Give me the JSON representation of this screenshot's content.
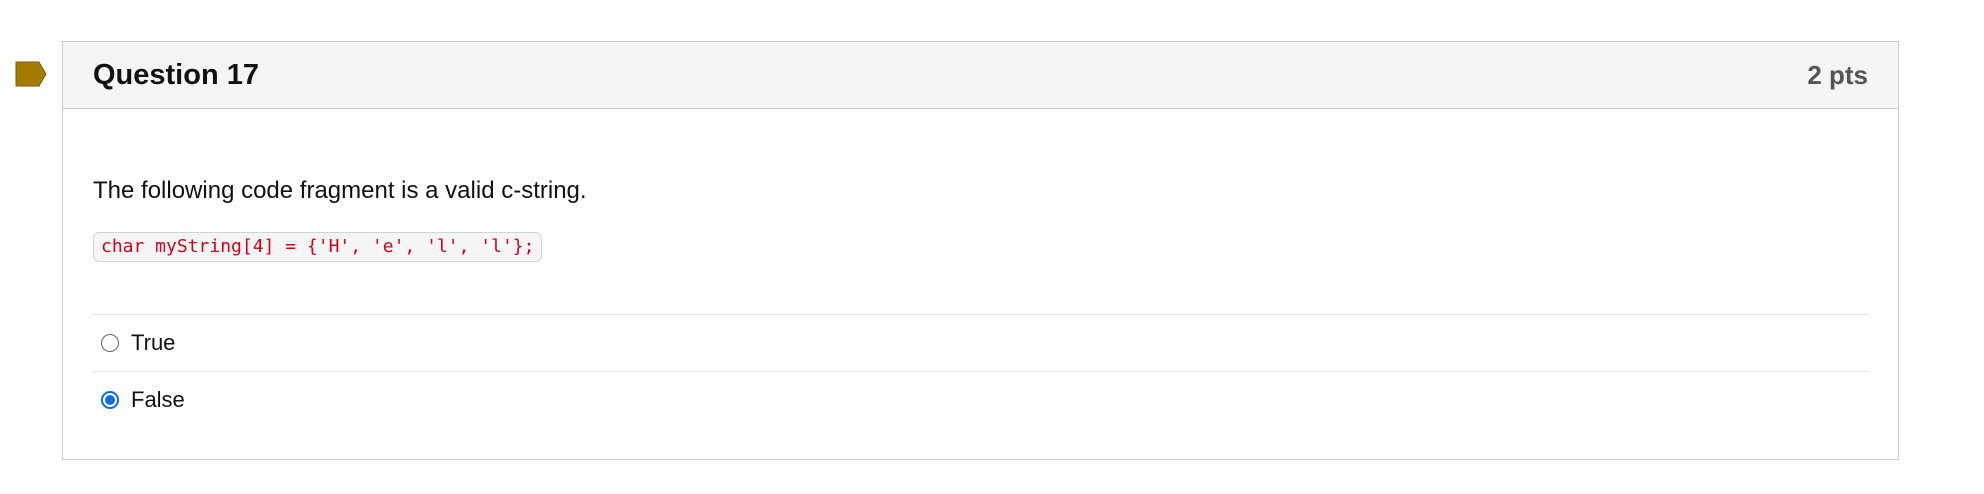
{
  "question": {
    "title": "Question 17",
    "points": "2 pts",
    "text": "The following code fragment is a valid c-string.",
    "code": "char myString[4] = {'H', 'e', 'l', 'l'};",
    "answers": [
      {
        "label": "True",
        "selected": false
      },
      {
        "label": "False",
        "selected": true
      }
    ]
  },
  "colors": {
    "flag": "#a67c00",
    "code_text": "#d0021b",
    "radio_selected": "#0a6ce0",
    "header_bg": "#f5f5f5"
  },
  "icons": {
    "flag": "flag-icon"
  }
}
